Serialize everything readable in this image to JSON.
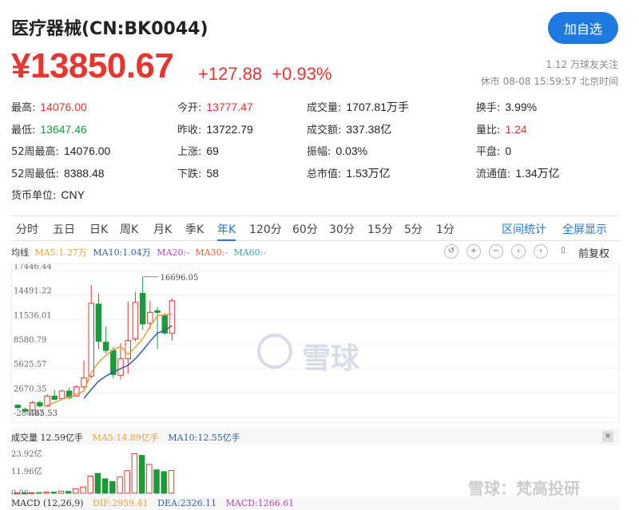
{
  "header": {
    "title": "医疗器械(CN:BK0044)",
    "follow_label": "加自选"
  },
  "quote": {
    "price": "¥13850.67",
    "change": "+127.88",
    "change_pct": "+0.93%",
    "followers": "1.12 万球友关注",
    "status": "休市 08-08 15:59:57 北京时间"
  },
  "stats": [
    {
      "label": "最高:",
      "value": "14076.00",
      "color": "red"
    },
    {
      "label": "今开:",
      "value": "13777.47",
      "color": "red"
    },
    {
      "label": "成交量:",
      "value": "1707.81万手",
      "color": ""
    },
    {
      "label": "换手:",
      "value": "3.99%",
      "color": ""
    },
    {
      "label": "最低:",
      "value": "13647.46",
      "color": "green"
    },
    {
      "label": "昨收:",
      "value": "13722.79",
      "color": ""
    },
    {
      "label": "成交额:",
      "value": "337.38亿",
      "color": ""
    },
    {
      "label": "量比:",
      "value": "1.24",
      "color": "red"
    },
    {
      "label": "52周最高:",
      "value": "14076.00",
      "color": ""
    },
    {
      "label": "上涨:",
      "value": "69",
      "color": ""
    },
    {
      "label": "振幅:",
      "value": "0.03%",
      "color": ""
    },
    {
      "label": "平盘:",
      "value": "0",
      "color": ""
    },
    {
      "label": "52周最低:",
      "value": "8388.48",
      "color": ""
    },
    {
      "label": "下跌:",
      "value": "58",
      "color": ""
    },
    {
      "label": "总市值:",
      "value": "1.53万亿",
      "color": ""
    },
    {
      "label": "流通值:",
      "value": "1.34万亿",
      "color": ""
    },
    {
      "label": "货币单位:",
      "value": "CNY",
      "color": ""
    }
  ],
  "tabs": [
    "分时",
    "五日",
    "日K",
    "周K",
    "月K",
    "季K",
    "年K",
    "120分",
    "60分",
    "30分",
    "15分",
    "5分",
    "1分"
  ],
  "active_tab": "年K",
  "tab_actions": [
    "区间统计",
    "全屏显示"
  ],
  "ma_legend": {
    "label": "均线",
    "ma5": "MA5:1.27万",
    "ma10": "MA10:1.04万",
    "ma20": "MA20:-",
    "ma30": "MA30:-",
    "ma60": "MA60:-"
  },
  "chart_controls": {
    "adjust": "前复权"
  },
  "chart_data": {
    "type": "candlestick",
    "y_ticks": [
      "17446.44",
      "14491.22",
      "11536.01",
      "8580.79",
      "5625.57",
      "2670.35",
      "-284.87"
    ],
    "ylim": [
      -284.87,
      17446.44
    ],
    "low_label": "465.53",
    "high_label": "16696.05",
    "candles": [
      {
        "o": 1200,
        "c": 900,
        "h": 1300,
        "l": 700
      },
      {
        "o": 700,
        "c": 465,
        "h": 900,
        "l": 465
      },
      {
        "o": 600,
        "c": 1500,
        "h": 1700,
        "l": 500
      },
      {
        "o": 1500,
        "c": 1100,
        "h": 1700,
        "l": 900
      },
      {
        "o": 1100,
        "c": 2300,
        "h": 2500,
        "l": 1000
      },
      {
        "o": 2300,
        "c": 1900,
        "h": 3000,
        "l": 1800
      },
      {
        "o": 2000,
        "c": 2900,
        "h": 3100,
        "l": 1900
      },
      {
        "o": 2900,
        "c": 2100,
        "h": 3300,
        "l": 1900
      },
      {
        "o": 2300,
        "c": 3400,
        "h": 3600,
        "l": 2200
      },
      {
        "o": 3400,
        "c": 4500,
        "h": 6600,
        "l": 3200
      },
      {
        "o": 4700,
        "c": 13500,
        "h": 15700,
        "l": 4400
      },
      {
        "o": 13400,
        "c": 8900,
        "h": 14700,
        "l": 8000
      },
      {
        "o": 8800,
        "c": 7800,
        "h": 10700,
        "l": 7400
      },
      {
        "o": 7800,
        "c": 4900,
        "h": 8200,
        "l": 4400
      },
      {
        "o": 4800,
        "c": 6800,
        "h": 8700,
        "l": 4300
      },
      {
        "o": 6800,
        "c": 9000,
        "h": 13700,
        "l": 5000
      },
      {
        "o": 9200,
        "c": 13600,
        "h": 14900,
        "l": 8900
      },
      {
        "o": 14700,
        "c": 11000,
        "h": 16700,
        "l": 10300
      },
      {
        "o": 11100,
        "c": 12400,
        "h": 13800,
        "l": 10400
      },
      {
        "o": 12600,
        "c": 12400,
        "h": 13000,
        "l": 8000
      },
      {
        "o": 12000,
        "c": 9900,
        "h": 12300,
        "l": 9700
      },
      {
        "o": 9900,
        "c": 13800,
        "h": 14100,
        "l": 9000
      }
    ],
    "ma5": [
      null,
      null,
      null,
      null,
      1200,
      1500,
      1900,
      2200,
      2500,
      2900,
      5100,
      6400,
      7200,
      7900,
      8300,
      7300,
      8200,
      9200,
      10700,
      12000,
      12100,
      12200
    ],
    "ma10": [
      null,
      null,
      null,
      null,
      null,
      null,
      null,
      null,
      null,
      2000,
      3100,
      4100,
      4700,
      5200,
      5600,
      6000,
      6800,
      7800,
      8900,
      9900,
      10200,
      10800
    ]
  },
  "volume": {
    "label": "成交量 12.59亿手",
    "ma5": "MA5:14.89亿手",
    "ma10": "MA10:12.55亿手",
    "y_ticks": [
      "23.92亿",
      "11.96亿",
      "0.00"
    ],
    "bars": [
      0.2,
      0.2,
      0.3,
      0.4,
      0.7,
      0.6,
      1.2,
      1.0,
      2.5,
      3.5,
      9.5,
      11.0,
      8.0,
      6.5,
      9.0,
      12.5,
      22.0,
      21.0,
      16.0,
      13.0,
      12.0,
      12.59
    ],
    "colors": [
      "up",
      "down",
      "up",
      "down",
      "up",
      "down",
      "up",
      "down",
      "up",
      "up",
      "up",
      "down",
      "down",
      "down",
      "up",
      "up",
      "up",
      "down",
      "up",
      "down",
      "down",
      "up"
    ]
  },
  "macd": {
    "label": "MACD (12,26,9)",
    "dif": "DIF:2959.41",
    "dea": "DEA:2326.11",
    "macd": "MACD:1266.61"
  },
  "footer_watermark": "雪球：梵高投研",
  "watermark_text": "雪球"
}
